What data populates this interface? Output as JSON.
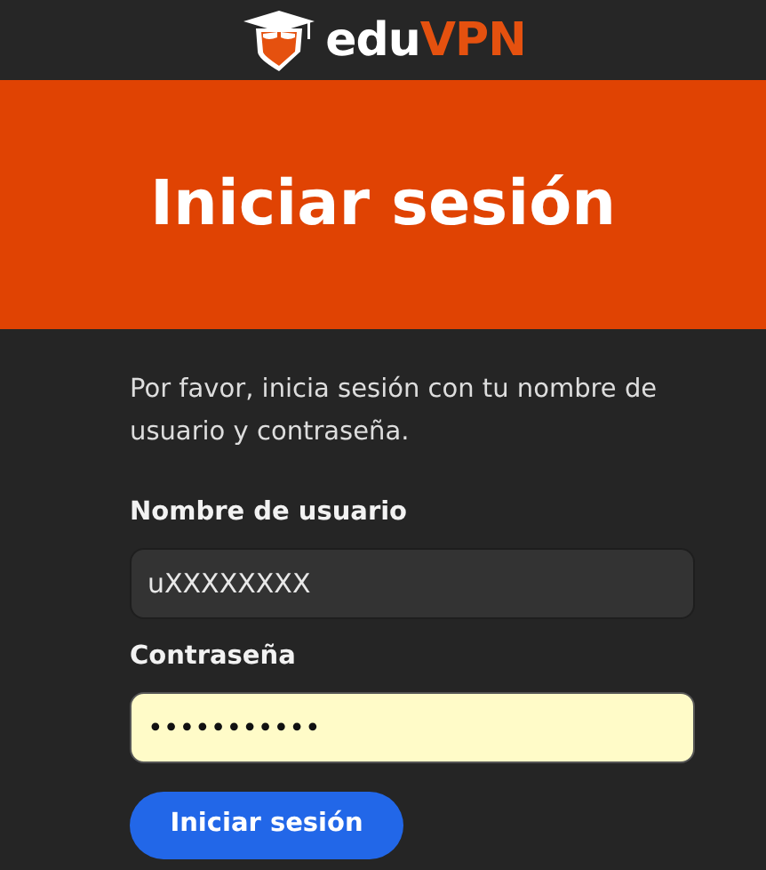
{
  "header": {
    "brand_prefix": "edu",
    "brand_suffix": "VPN"
  },
  "banner": {
    "title": "Iniciar sesión"
  },
  "form": {
    "intro": "Por favor, inicia sesión con tu nombre de usuario y contraseña.",
    "fields": [
      {
        "label": "Nombre de usuario",
        "value": "uXXXXXXXX",
        "autofilled": false
      },
      {
        "label": "Contraseña",
        "value": "•••••••••••",
        "autofilled": true
      }
    ],
    "submit": "Iniciar sesión"
  }
}
